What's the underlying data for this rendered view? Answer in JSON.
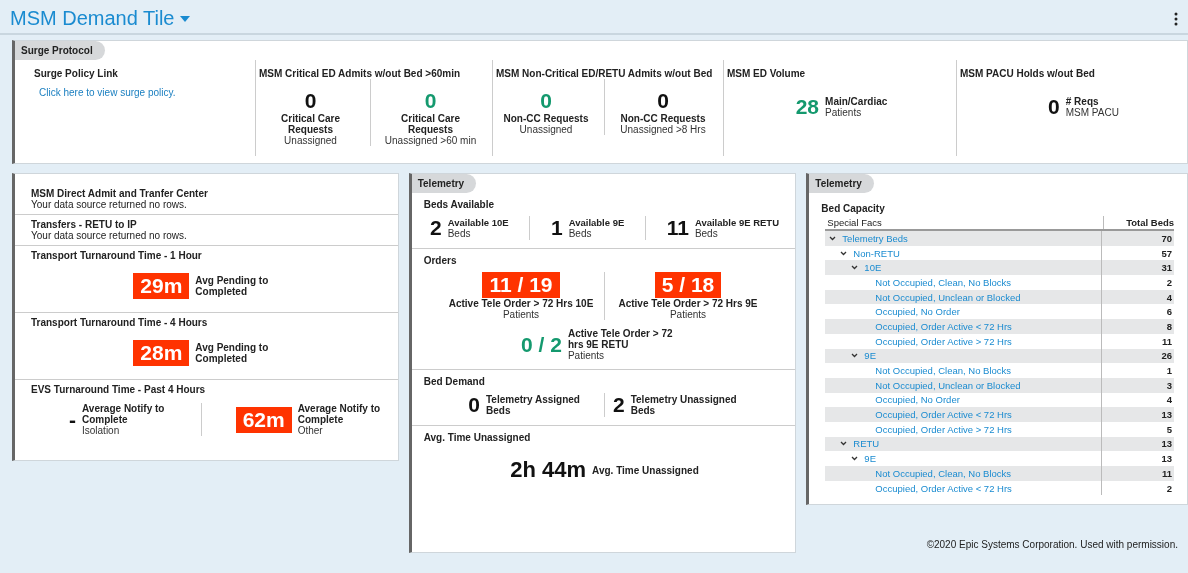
{
  "header": {
    "title": "MSM Demand Tile"
  },
  "surge": {
    "tab": "Surge Protocol",
    "columns": [
      {
        "kind": "link",
        "title": "Surge Policy Link",
        "link": "Click here to view surge policy."
      },
      {
        "kind": "stacked",
        "title": "MSM Critical ED Admits w/out Bed >60min",
        "metrics": [
          {
            "value": "0",
            "kind": "plain",
            "label": "Critical Care Requests",
            "sub": "Unassigned"
          },
          {
            "value": "0",
            "kind": "good",
            "label": "Critical Care Requests",
            "sub": "Unassigned >60 min"
          }
        ]
      },
      {
        "kind": "stacked",
        "title": "MSM Non-Critical ED/RETU Admits w/out Bed",
        "metrics": [
          {
            "value": "0",
            "kind": "good",
            "label": "Non-CC Requests",
            "sub": "Unassigned"
          },
          {
            "value": "0",
            "kind": "plain",
            "label": "Non-CC Requests",
            "sub": "Unassigned >8 Hrs"
          }
        ]
      },
      {
        "kind": "inline",
        "title": "MSM ED Volume",
        "metrics": [
          {
            "value": "28",
            "kind": "good",
            "label": "Main/Cardiac",
            "sub": "Patients"
          }
        ]
      },
      {
        "kind": "inline",
        "title": "MSM PACU Holds w/out Bed",
        "metrics": [
          {
            "value": "0",
            "kind": "plain",
            "label": "# Reqs",
            "sub": "MSM PACU"
          }
        ]
      }
    ]
  },
  "left_panel": {
    "sections": [
      {
        "title": "MSM Direct Admit and Tranfer Center",
        "message": "Your data source returned no rows."
      },
      {
        "title": "Transfers - RETU to IP",
        "message": "Your data source returned no rows."
      },
      {
        "title": "Transport Turnaround Time - 1 Hour",
        "groups": [
          {
            "kind": "inline",
            "metrics": [
              {
                "value": "29m",
                "kind": "alert",
                "label": "Avg Pending to Completed"
              }
            ]
          }
        ]
      },
      {
        "title": "Transport Turnaround Time - 4 Hours",
        "groups": [
          {
            "kind": "inline",
            "metrics": [
              {
                "value": "28m",
                "kind": "alert",
                "label": "Avg Pending to Completed"
              }
            ]
          }
        ]
      },
      {
        "title": "EVS Turnaround Time - Past 4 Hours",
        "groups": [
          {
            "kind": "inline",
            "metrics": [
              {
                "value": "-",
                "kind": "plain",
                "label": "Average Notify to Complete",
                "sub": "Isolation"
              },
              {
                "value": "62m",
                "kind": "alert",
                "label": "Average Notify to Complete",
                "sub": "Other"
              }
            ]
          }
        ]
      }
    ]
  },
  "middle_panel": {
    "tab": "Telemetry",
    "sections": [
      {
        "title": "Beds Available",
        "groups": [
          {
            "kind": "inline",
            "metrics": [
              {
                "value": "2",
                "kind": "plain",
                "label": "Available 10E",
                "sub": "Beds"
              },
              {
                "value": "1",
                "kind": "plain",
                "label": "Available 9E",
                "sub": "Beds"
              },
              {
                "value": "11",
                "kind": "plain",
                "label": "Available 9E RETU",
                "sub": "Beds"
              }
            ]
          }
        ]
      },
      {
        "title": "Orders",
        "groups": [
          {
            "kind": "stacked",
            "metrics": [
              {
                "value": "11 / 19",
                "kind": "alert",
                "label": "Active Tele Order > 72 Hrs 10E",
                "sub": "Patients"
              },
              {
                "value": "5 / 18",
                "kind": "alert",
                "label": "Active Tele Order > 72 Hrs 9E",
                "sub": "Patients"
              }
            ]
          },
          {
            "kind": "inline",
            "metrics": [
              {
                "value": "0 / 2",
                "kind": "good",
                "label": "Active Tele Order > 72 hrs 9E RETU",
                "sub": "Patients"
              }
            ]
          }
        ]
      },
      {
        "title": "Bed Demand",
        "groups": [
          {
            "kind": "inline",
            "metrics": [
              {
                "value": "0",
                "kind": "plain",
                "label": "Telemetry Assigned Beds"
              },
              {
                "value": "2",
                "kind": "plain",
                "label": "Telemetry Unassigned Beds"
              }
            ]
          }
        ]
      },
      {
        "title": "Avg. Time Unassigned",
        "groups": [
          {
            "kind": "inline",
            "metrics": [
              {
                "value": "2h 44m",
                "kind": "plain",
                "label": "Avg. Time Unassigned"
              }
            ]
          }
        ]
      }
    ]
  },
  "right_panel": {
    "tab": "Telemetry",
    "title": "Bed Capacity",
    "columns": [
      "Special Facs",
      "Total Beds"
    ],
    "rows": [
      {
        "label": "Telemetry Beds",
        "total": "70",
        "expanded": true,
        "children": [
          {
            "label": "Non-RETU",
            "total": "57",
            "expanded": true,
            "children": [
              {
                "label": "10E",
                "total": "31",
                "expanded": true,
                "children": [
                  {
                    "label": "Not Occupied, Clean, No Blocks",
                    "total": "2"
                  },
                  {
                    "label": "Not Occupied, Unclean or Blocked",
                    "total": "4"
                  },
                  {
                    "label": "Occupied, No Order",
                    "total": "6"
                  },
                  {
                    "label": "Occupied, Order Active < 72 Hrs",
                    "total": "8"
                  },
                  {
                    "label": "Occupied, Order Active > 72 Hrs",
                    "total": "11"
                  }
                ]
              },
              {
                "label": "9E",
                "total": "26",
                "expanded": true,
                "children": [
                  {
                    "label": "Not Occupied, Clean, No Blocks",
                    "total": "1"
                  },
                  {
                    "label": "Not Occupied, Unclean or Blocked",
                    "total": "3"
                  },
                  {
                    "label": "Occupied, No Order",
                    "total": "4"
                  },
                  {
                    "label": "Occupied, Order Active < 72 Hrs",
                    "total": "13"
                  },
                  {
                    "label": "Occupied, Order Active > 72 Hrs",
                    "total": "5"
                  }
                ]
              }
            ]
          },
          {
            "label": "RETU",
            "total": "13",
            "expanded": true,
            "children": [
              {
                "label": "9E",
                "total": "13",
                "expanded": true,
                "children": [
                  {
                    "label": "Not Occupied, Clean, No Blocks",
                    "total": "11"
                  },
                  {
                    "label": "Occupied, Order Active < 72 Hrs",
                    "total": "2"
                  }
                ]
              }
            ]
          }
        ]
      }
    ]
  },
  "footer": "©2020 Epic Systems Corporation. Used with permission."
}
